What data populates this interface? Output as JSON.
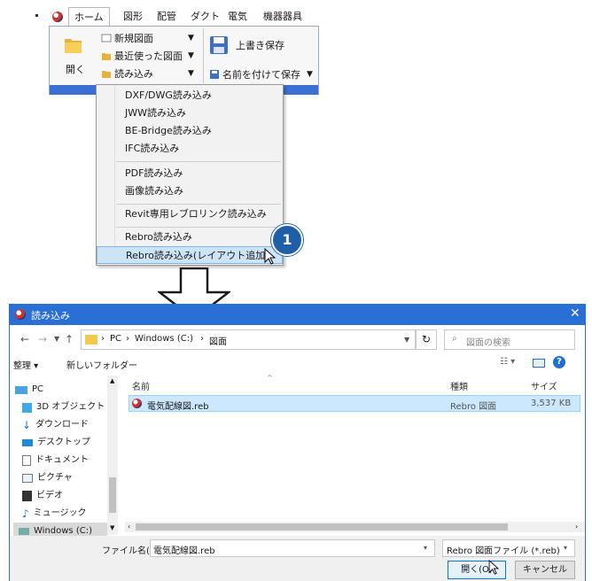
{
  "ribbon": {
    "tabs": [
      "ホーム",
      "図形",
      "配管",
      "ダクト",
      "電気",
      "機器器具"
    ],
    "open_label": "開く",
    "new_drawing": "新規図面",
    "recent_drawing": "最近使った図面",
    "import": "読み込み",
    "overwrite_save": "上書き保存",
    "save_as": "名前を付けて保存"
  },
  "menu": {
    "items": [
      "DXF/DWG読み込み",
      "JWW読み込み",
      "BE-Bridge読み込み",
      "IFC読み込み",
      "PDF読み込み",
      "画像読み込み",
      "Revit専用レブロリンク読み込み",
      "Rebro読み込み",
      "Rebro読み込み(レイアウト追加)"
    ]
  },
  "callout": "1",
  "dialog": {
    "title": "読み込み",
    "breadcrumb": [
      "PC",
      "Windows (C:)",
      "図面"
    ],
    "search_placeholder": "図面の検索",
    "organize": "整理 ▾",
    "new_folder": "新しいフォルダー",
    "nav": [
      "PC",
      "3D オブジェクト",
      "ダウンロード",
      "デスクトップ",
      "ドキュメント",
      "ピクチャ",
      "ビデオ",
      "ミュージック",
      "Windows (C:)"
    ],
    "columns": {
      "name": "名前",
      "type": "種類",
      "size": "サイズ"
    },
    "file": {
      "name": "電気配線図.reb",
      "type": "Rebro 図面",
      "size": "3,537 KB"
    },
    "filename_label": "ファイル名(N):",
    "filename_value": "電気配線図.reb",
    "filetype": "Rebro 図面ファイル (*.reb)",
    "open_btn": "開く(O)",
    "cancel_btn": "キャンセル"
  },
  "colors": {
    "accent": "#2a6fd6",
    "highlight": "#cde4f7",
    "callout": "#1f5fa8"
  }
}
